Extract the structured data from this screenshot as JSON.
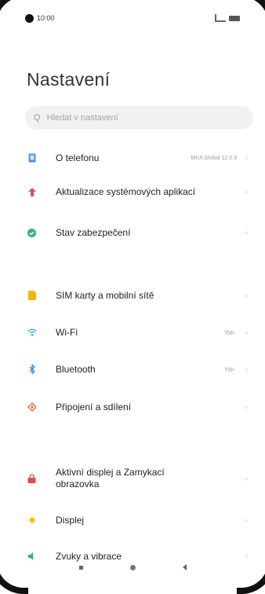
{
  "status_bar": {
    "time": "10:00",
    "signal": "signal-icon",
    "battery": "battery-icon"
  },
  "page": {
    "title": "Nastavení"
  },
  "search": {
    "placeholder": "Hledat v nastavení"
  },
  "items": [
    {
      "label": "O telefonu",
      "value": "MIUI Global 12.0.9",
      "icon": "phone-info-icon",
      "color": "#4a90e2"
    },
    {
      "label": "Aktualizace systémových aplikací",
      "value": "",
      "icon": "arrow-up-icon",
      "color": "#e94b4b"
    },
    {
      "label": "Stav zabezpečení",
      "value": "",
      "icon": "shield-icon",
      "color": "#2bb673"
    },
    {
      "label": "SIM karty a mobilní sítě",
      "value": "",
      "icon": "sim-icon",
      "color": "#f4b400"
    },
    {
      "label": "Wi-Fi",
      "value": "Vyp.",
      "icon": "wifi-icon",
      "color": "#1aa3e8"
    },
    {
      "label": "Bluetooth",
      "value": "Vyp.",
      "icon": "bluetooth-icon",
      "color": "#1d7fe0"
    },
    {
      "label": "Připojení a sdílení",
      "value": "",
      "icon": "connection-icon",
      "color": "#e8683a"
    },
    {
      "label": "Aktivní displej a Zamykací obrazovka",
      "value": "",
      "icon": "lock-icon",
      "color": "#e94b4b"
    },
    {
      "label": "Displej",
      "value": "",
      "icon": "sun-icon",
      "color": "#f4c20d"
    },
    {
      "label": "Zvuky a vibrace",
      "value": "",
      "icon": "sound-icon",
      "color": "#2bb673"
    }
  ]
}
